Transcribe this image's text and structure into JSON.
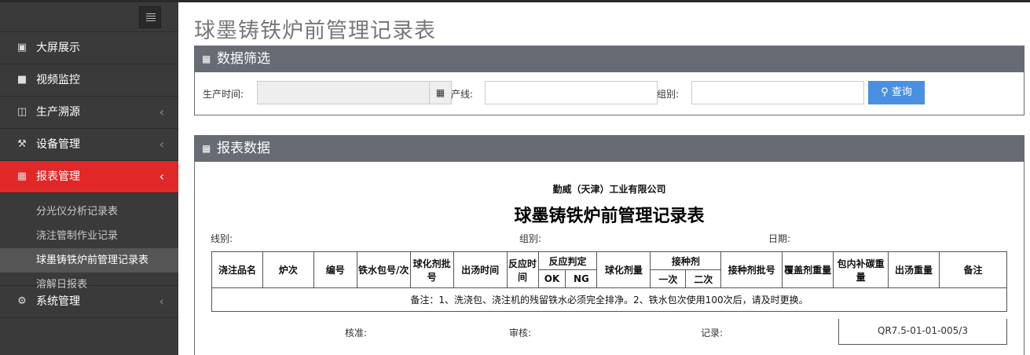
{
  "page_title": "球墨铸铁炉前管理记录表",
  "sidebar": {
    "items": [
      {
        "label": "大屏展示",
        "icon": "monitor-icon"
      },
      {
        "label": "视频监控",
        "icon": "video-camera-icon"
      },
      {
        "label": "生产溯源",
        "icon": "book-icon"
      },
      {
        "label": "设备管理",
        "icon": "wrench-icon"
      },
      {
        "label": "报表管理",
        "icon": "bar-chart-icon"
      },
      {
        "label": "系统管理",
        "icon": "gears-icon"
      }
    ],
    "subitems": [
      "分光仪分析记录表",
      "浇注管制作业记录",
      "球墨铸铁炉前管理记录表",
      "溶解日报表"
    ]
  },
  "filter": {
    "title": "数据筛选",
    "production_time_label": "生产时间:",
    "production_line_label": "产线:",
    "group_label": "组别:",
    "query_label": "查询"
  },
  "report": {
    "panel_title": "报表数据",
    "company": "勤威（天津）工业有限公司",
    "title": "球墨铸铁炉前管理记录表",
    "line_label": "线别:",
    "group_label": "组别:",
    "date_label": "日期:",
    "headers": {
      "pour_product": "浇注品名",
      "furnace": "炉次",
      "number": "编号",
      "iron_ladle": "铁水包号/次",
      "spheroidizer_batch": "球化剂批号",
      "tap_time": "出汤时间",
      "reaction_time": "反应时间",
      "reaction_judge": "反应判定",
      "ok": "OK",
      "ng": "NG",
      "spheroidizer_amount": "球化剂量",
      "inoculant": "接种剂",
      "first": "一次",
      "second": "二次",
      "inoculant_batch": "接种剂批号",
      "cover_weight": "覆盖剂重量",
      "carbon_weight": "包内补碳重量",
      "tap_weight": "出汤重量",
      "remarks": "备注"
    },
    "note": "备注：1、洗浇包、浇注机的残留铁水必须完全排净。2、铁水包次使用100次后，请及时更换。",
    "approve_label": "核准:",
    "review_label": "审核:",
    "record_label": "记录:",
    "form_code": "QR7.5-01-01-005/3"
  }
}
